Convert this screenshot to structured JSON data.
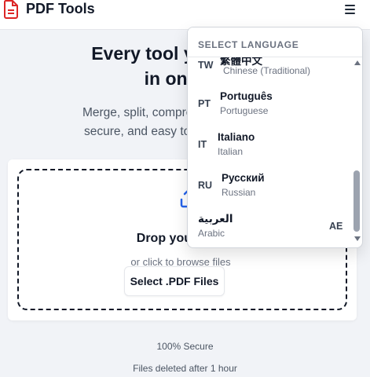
{
  "header": {
    "title": "PDF Tools",
    "logo_icon": "pdf-file-icon",
    "menu_icon": "hamburger-menu-icon"
  },
  "hero": {
    "title_line1": "Every tool you need",
    "title_line2": "in one",
    "subtitle_line1": "Merge, split, compress, and co",
    "subtitle_line2": "secure, and easy to use - n"
  },
  "upload": {
    "icon": "upload-icon",
    "title": "Drop your",
    "subtitle": "or click to browse files",
    "button_label": "Select .PDF Files"
  },
  "footer": {
    "secure": "100% Secure",
    "deleted": "Files deleted after 1 hour"
  },
  "language_menu": {
    "header": "SELECT LANGUAGE",
    "items": [
      {
        "code": "TW",
        "native": "繁體中文",
        "english": "Chinese (Traditional)"
      },
      {
        "code": "PT",
        "native": "Português",
        "english": "Portuguese"
      },
      {
        "code": "IT",
        "native": "Italiano",
        "english": "Italian"
      },
      {
        "code": "RU",
        "native": "Русский",
        "english": "Russian"
      },
      {
        "code": "AE",
        "native": "العربية",
        "english": "Arabic"
      }
    ]
  },
  "colors": {
    "accent": "#2563eb",
    "logo": "#dc2626",
    "background": "#f1f3f7"
  }
}
